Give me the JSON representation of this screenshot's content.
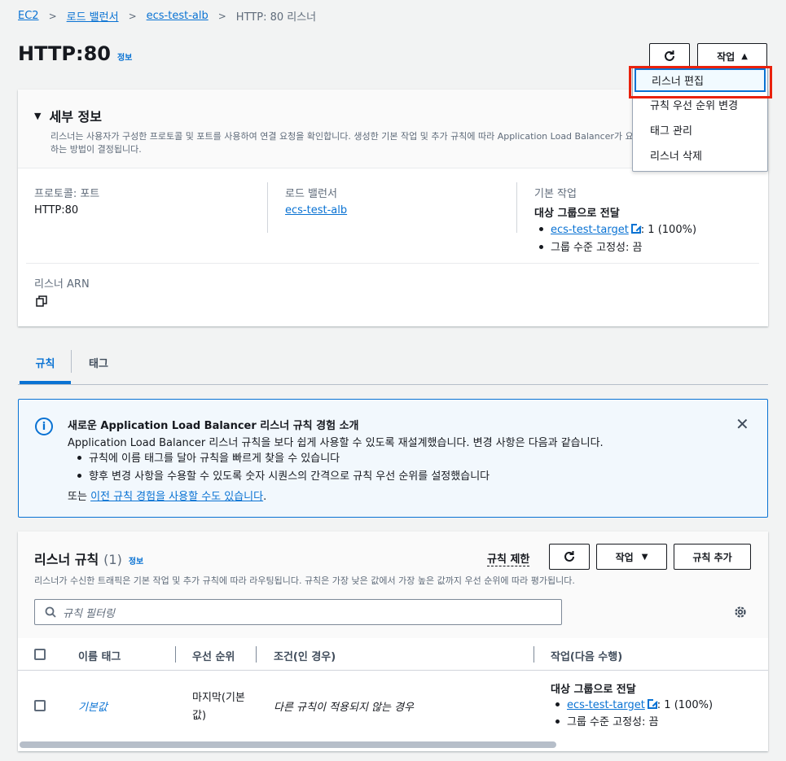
{
  "breadcrumb": [
    "EC2",
    "로드 밸런서",
    "ecs-test-alb",
    "HTTP: 80 리스너"
  ],
  "page": {
    "title": "HTTP:80",
    "info": "정보"
  },
  "header_buttons": {
    "actions": "작업"
  },
  "actions_menu": [
    "리스너 편집",
    "규칙 우선 순위 변경",
    "태그 관리",
    "리스너 삭제"
  ],
  "details": {
    "heading": "세부 정보",
    "description": "리스너는 사용자가 구성한 프로토콜 및 포트를 사용하여 연결 요청을 확인합니다. 생성한 기본 작업 및 추가 규칙에 따라 Application Load Balancer가 요",
    "description2": "하는 방법이 결정됩니다.",
    "protocol_label": "프로토콜: 포트",
    "protocol_value": "HTTP:80",
    "lb_label": "로드 밸런서",
    "lb_value": "ecs-test-alb",
    "default_label": "기본 작업",
    "default_title": "대상 그룹으로 전달",
    "target": "ecs-test-target",
    "target_weight": ": 1 (100%)",
    "stickiness": "그룹 수준 고정성: 끔",
    "arn_label": "리스너 ARN"
  },
  "tabs": [
    "규칙",
    "태그"
  ],
  "alert": {
    "title": "새로운 Application Load Balancer 리스너 규칙 경험 소개",
    "body": "Application Load Balancer 리스너 규칙을 보다 쉽게 사용할 수 있도록 재설계했습니다. 변경 사항은 다음과 같습니다.",
    "bullets": [
      "규칙에 이름 태그를 달아 규칙을 빠르게 찾을 수 있습니다",
      "향후 변경 사항을 수용할 수 있도록 숫자 시퀀스의 간격으로 규칙 우선 순위를 설정했습니다"
    ],
    "footer_pre": "또는 ",
    "footer_link": "이전 규칙 경험을 사용할 수도 있습니다",
    "footer_post": "."
  },
  "rules": {
    "title": "리스너 규칙",
    "count": "(1)",
    "info": "정보",
    "limit": "규칙 제한",
    "actions": "작업",
    "add": "규칙 추가",
    "description": "리스너가 수신한 트래픽은 기본 작업 및 추가 규칙에 따라 라우팅됩니다. 규칙은 가장 낮은 값에서 가장 높은 값까지 우선 순위에 따라 평가됩니다.",
    "filter_placeholder": "규칙 필터링",
    "columns": [
      "이름 태그",
      "우선 순위",
      "조건(인 경우)",
      "작업(다음 수행)"
    ],
    "row": {
      "name": "기본값",
      "priority": "마지막(기본값)",
      "condition": "다른 규칙이 적용되지 않는 경우",
      "action_title": "대상 그룹으로 전달",
      "target": "ecs-test-target",
      "weight": ": 1 (100%)",
      "stickiness": "그룹 수준 고정성: 끔"
    }
  }
}
